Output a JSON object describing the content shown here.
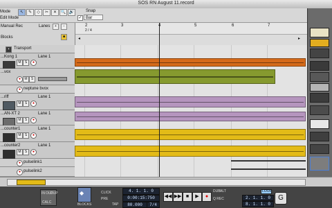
{
  "window": {
    "title": "SOS RN August 11.record"
  },
  "toolbar": {
    "mode_top": "Mode",
    "mode_bottom": "Edit Mode",
    "tools": [
      "↖",
      "✎",
      "◇",
      "✂",
      "✕",
      "🔍",
      "🔊"
    ],
    "snap_label": "Snap",
    "snap_value": "Bar"
  },
  "left_header": {
    "blocks_label": "Blocks",
    "manual_rec_label": "Manual Rec",
    "lanes_label": "Lanes"
  },
  "ruler": {
    "markers": [
      "2",
      "3",
      "4",
      "5",
      "6",
      "7"
    ],
    "selection_label": "2 / 4"
  },
  "tracks": [
    {
      "name": "Transport",
      "lane": ""
    },
    {
      "name": "...Kong 1",
      "lane": "Lane 1"
    },
    {
      "name": "...vox",
      "lane": ""
    },
    {
      "name": "neptune bvox",
      "lane": ""
    },
    {
      "name": "...riff",
      "lane": "Lane 1"
    },
    {
      "name": "...AN-XT 2",
      "lane": "Lane 1"
    },
    {
      "name": "...counter1",
      "lane": "Lane 1"
    },
    {
      "name": "...counter2",
      "lane": "Lane 1"
    },
    {
      "name": "pulselink1",
      "lane": ""
    },
    {
      "name": "pulselink2",
      "lane": ""
    }
  ],
  "transport": {
    "blocks_label": "BLOCKS",
    "click_label": "CLICK",
    "pre_label": "PRE",
    "tap_label": "TAP",
    "position": "4. 1. 1. 0",
    "time": "0:00:15:750",
    "tempo": "80.000",
    "signature": "7/4",
    "loop_label": "LOOP",
    "loop_start": "2. 1. 1. 0",
    "loop_end": "8. 1. 1. 0",
    "in_label": "IN",
    "out_label": "OUT",
    "dup_label": "DUP",
    "calc_label": "CALC",
    "dub_label": "DUB",
    "alt_label": "ALT",
    "q_rec_label": "Q REC"
  },
  "colors": {
    "orange": "#d56a1a",
    "olive": "#869a2f",
    "purple": "#b595be",
    "yellow": "#e3bb17",
    "track_bg": "#c9c9c9",
    "transport_bg": "#444444"
  },
  "icons": {
    "rewind": "rewind-icon",
    "forward": "fast-forward-icon",
    "stop": "stop-icon",
    "play": "play-icon",
    "record": "record-icon"
  }
}
